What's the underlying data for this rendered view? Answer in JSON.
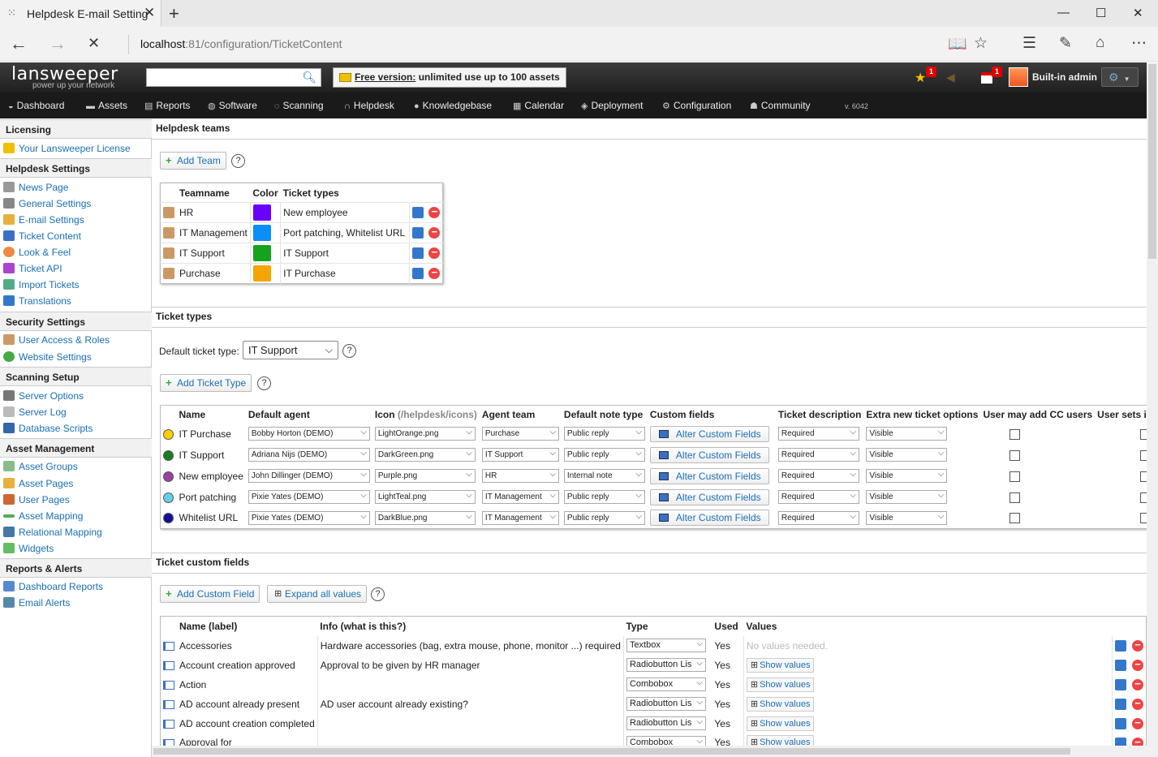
{
  "browser": {
    "tab_title": "Helpdesk E-mail Setting",
    "address_host": "localhost",
    "address_path": ":81/configuration/TicketContent"
  },
  "header": {
    "logo_text": "lansweeper",
    "tagline": "power up your network",
    "free_banner_link": "Free version:",
    "free_banner_text": " unlimited use up to 100 assets",
    "badge1": "1",
    "badge2": "1",
    "user_name": "Built-in admin",
    "version": "v. 6042"
  },
  "nav": [
    {
      "label": "Dashboard",
      "icon": "dashboard-icon"
    },
    {
      "label": "Assets",
      "icon": "monitor-icon"
    },
    {
      "label": "Reports",
      "icon": "report-icon"
    },
    {
      "label": "Software",
      "icon": "software-icon"
    },
    {
      "label": "Scanning",
      "icon": "scanning-icon"
    },
    {
      "label": "Helpdesk",
      "icon": "headset-icon"
    },
    {
      "label": "Knowledgebase",
      "icon": "info-icon"
    },
    {
      "label": "Calendar",
      "icon": "calendar-icon"
    },
    {
      "label": "Deployment",
      "icon": "deployment-icon"
    },
    {
      "label": "Configuration",
      "icon": "gear-icon"
    },
    {
      "label": "Community",
      "icon": "community-icon"
    }
  ],
  "sidebar": {
    "licensing": "Licensing",
    "license_item": "Your Lansweeper License",
    "helpdesk_settings": "Helpdesk Settings",
    "helpdesk_items": [
      "News Page",
      "General Settings",
      "E-mail Settings",
      "Ticket Content",
      "Look & Feel",
      "Ticket API",
      "Import Tickets",
      "Translations"
    ],
    "security_settings": "Security Settings",
    "security_items": [
      "User Access & Roles",
      "Website Settings"
    ],
    "scanning_setup": "Scanning Setup",
    "scanning_items": [
      "Server Options",
      "Server Log",
      "Database Scripts"
    ],
    "asset_management": "Asset Management",
    "asset_items": [
      "Asset Groups",
      "Asset Pages",
      "User Pages",
      "Asset Mapping",
      "Relational Mapping",
      "Widgets"
    ],
    "reports_alerts": "Reports & Alerts",
    "reports_items": [
      "Dashboard Reports",
      "Email Alerts"
    ]
  },
  "teams": {
    "section_title": "Helpdesk teams",
    "add_button": "Add Team",
    "help": "?",
    "col_teamname": "Teamname",
    "col_color": "Color",
    "col_types": "Ticket types",
    "rows": [
      {
        "name": "HR",
        "color": "#6a00ff",
        "types": "New employee"
      },
      {
        "name": "IT Management",
        "color": "#0a8ef8",
        "types": "Port patching, Whitelist URL"
      },
      {
        "name": "IT Support",
        "color": "#16a31c",
        "types": "IT Support"
      },
      {
        "name": "Purchase",
        "color": "#f6a500",
        "types": "IT Purchase"
      }
    ]
  },
  "ticket_types": {
    "section_title": "Ticket types",
    "default_label": "Default ticket type:",
    "default_value": "IT Support",
    "add_button": "Add Ticket Type",
    "help": "?",
    "cols": {
      "name": "Name",
      "agent": "Default agent",
      "icon": "Icon",
      "icon_path": "(/helpdesk/icons)",
      "team": "Agent team",
      "note": "Default note type",
      "custom": "Custom fields",
      "desc": "Ticket description",
      "extra": "Extra new ticket options",
      "cc": "User may add CC users",
      "init": "User sets init"
    },
    "rows": [
      {
        "dot": "#f7d000",
        "name": "IT Purchase",
        "agent": "Bobby Horton (DEMO)",
        "icon": "LightOrange.png",
        "team": "Purchase",
        "note": "Public reply",
        "custom": "Alter Custom Fields",
        "desc": "Required",
        "extra": "Visible"
      },
      {
        "dot": "#1a7d20",
        "name": "IT Support",
        "agent": "Adriana Nijs (DEMO)",
        "icon": "DarkGreen.png",
        "team": "IT Support",
        "note": "Public reply",
        "custom": "Alter Custom Fields",
        "desc": "Required",
        "extra": "Visible"
      },
      {
        "dot": "#9b3fa0",
        "name": "New employee",
        "agent": "John Dillinger (DEMO)",
        "icon": "Purple.png",
        "team": "HR",
        "note": "Internal note",
        "custom": "Alter Custom Fields",
        "desc": "Required",
        "extra": "Visible"
      },
      {
        "dot": "#5fd0e8",
        "name": "Port patching",
        "agent": "Pixie Yates (DEMO)",
        "icon": "LightTeal.png",
        "team": "IT Management",
        "note": "Public reply",
        "custom": "Alter Custom Fields",
        "desc": "Required",
        "extra": "Visible"
      },
      {
        "dot": "#10109a",
        "name": "Whitelist URL",
        "agent": "Pixie Yates (DEMO)",
        "icon": "DarkBlue.png",
        "team": "IT Management",
        "note": "Public reply",
        "custom": "Alter Custom Fields",
        "desc": "Required",
        "extra": "Visible"
      }
    ]
  },
  "custom_fields": {
    "section_title": "Ticket custom fields",
    "add_button": "Add Custom Field",
    "expand_button": "Expand all values",
    "help": "?",
    "cols": {
      "name": "Name (label)",
      "info": "Info (what is this?)",
      "type": "Type",
      "used": "Used",
      "values": "Values"
    },
    "rows": [
      {
        "name": "Accessories",
        "info": "Hardware accessories (bag, extra mouse, phone, monitor ...) required",
        "type": "Textbox",
        "used": "Yes",
        "values": "No values needed."
      },
      {
        "name": "Account creation approved",
        "info": "Approval to be given by HR manager",
        "type": "Radiobutton Lis",
        "used": "Yes",
        "values": "Show values"
      },
      {
        "name": "Action",
        "info": "",
        "type": "Combobox",
        "used": "Yes",
        "values": "Show values"
      },
      {
        "name": "AD account already present",
        "info": "AD user account already existing?",
        "type": "Radiobutton Lis",
        "used": "Yes",
        "values": "Show values"
      },
      {
        "name": "AD account creation completed",
        "info": "",
        "type": "Radiobutton Lis",
        "used": "Yes",
        "values": "Show values"
      },
      {
        "name": "Approval for",
        "info": "",
        "type": "Combobox",
        "used": "Yes",
        "values": "Show values"
      }
    ]
  }
}
